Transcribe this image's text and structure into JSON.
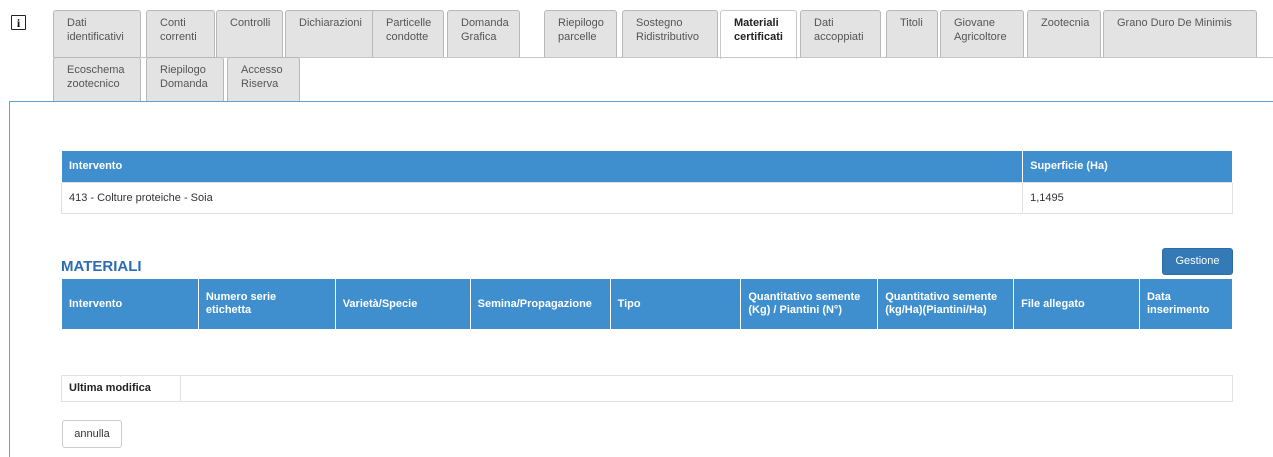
{
  "info_icon": {
    "glyph": "i",
    "name": "info-icon"
  },
  "tabs": [
    {
      "label": "Dati\nidentificativi"
    },
    {
      "label": "Conti\ncorrenti"
    },
    {
      "label": "Controlli"
    },
    {
      "label": "Dichiarazioni"
    },
    {
      "label": "Particelle\ncondotte"
    },
    {
      "label": "Domanda\nGrafica"
    },
    {
      "label": "Riepilogo\nparcelle"
    },
    {
      "label": "Sostegno\nRidistributivo"
    },
    {
      "label": "Materiali\ncertificati",
      "active": true
    },
    {
      "label": "Dati\naccoppiati"
    },
    {
      "label": "Titoli"
    },
    {
      "label": "Giovane\nAgricoltore"
    },
    {
      "label": "Zootecnia"
    },
    {
      "label": "Grano Duro De Minimis"
    },
    {
      "label": "Ecoschema\nzootecnico"
    },
    {
      "label": "Riepilogo\nDomanda"
    },
    {
      "label": "Accesso\nRiserva"
    }
  ],
  "intervento_table": {
    "headers": {
      "intervento": "Intervento",
      "superficie": "Superficie (Ha)"
    },
    "rows": [
      {
        "intervento": "413 - Colture proteiche - Soia",
        "superficie": "1,1495"
      }
    ]
  },
  "materiali": {
    "title": "MATERIALI",
    "gestione_label": "Gestione",
    "headers": [
      "Intervento",
      "Numero serie\netichetta",
      "Varietà/Specie",
      "Semina/Propagazione",
      "Tipo",
      "Quantitativo semente\n(Kg) / Piantini (N°)",
      "Quantitativo semente\n(kg/Ha)(Piantini/Ha)",
      "File allegato",
      "Data\ninserimento"
    ]
  },
  "ultima_modifica": {
    "label": "Ultima modifica",
    "value": ""
  },
  "annulla_label": "annulla",
  "colors": {
    "header_blue": "#3f8fce",
    "primary_button": "#337ab7",
    "title_blue": "#2b6cb3"
  }
}
